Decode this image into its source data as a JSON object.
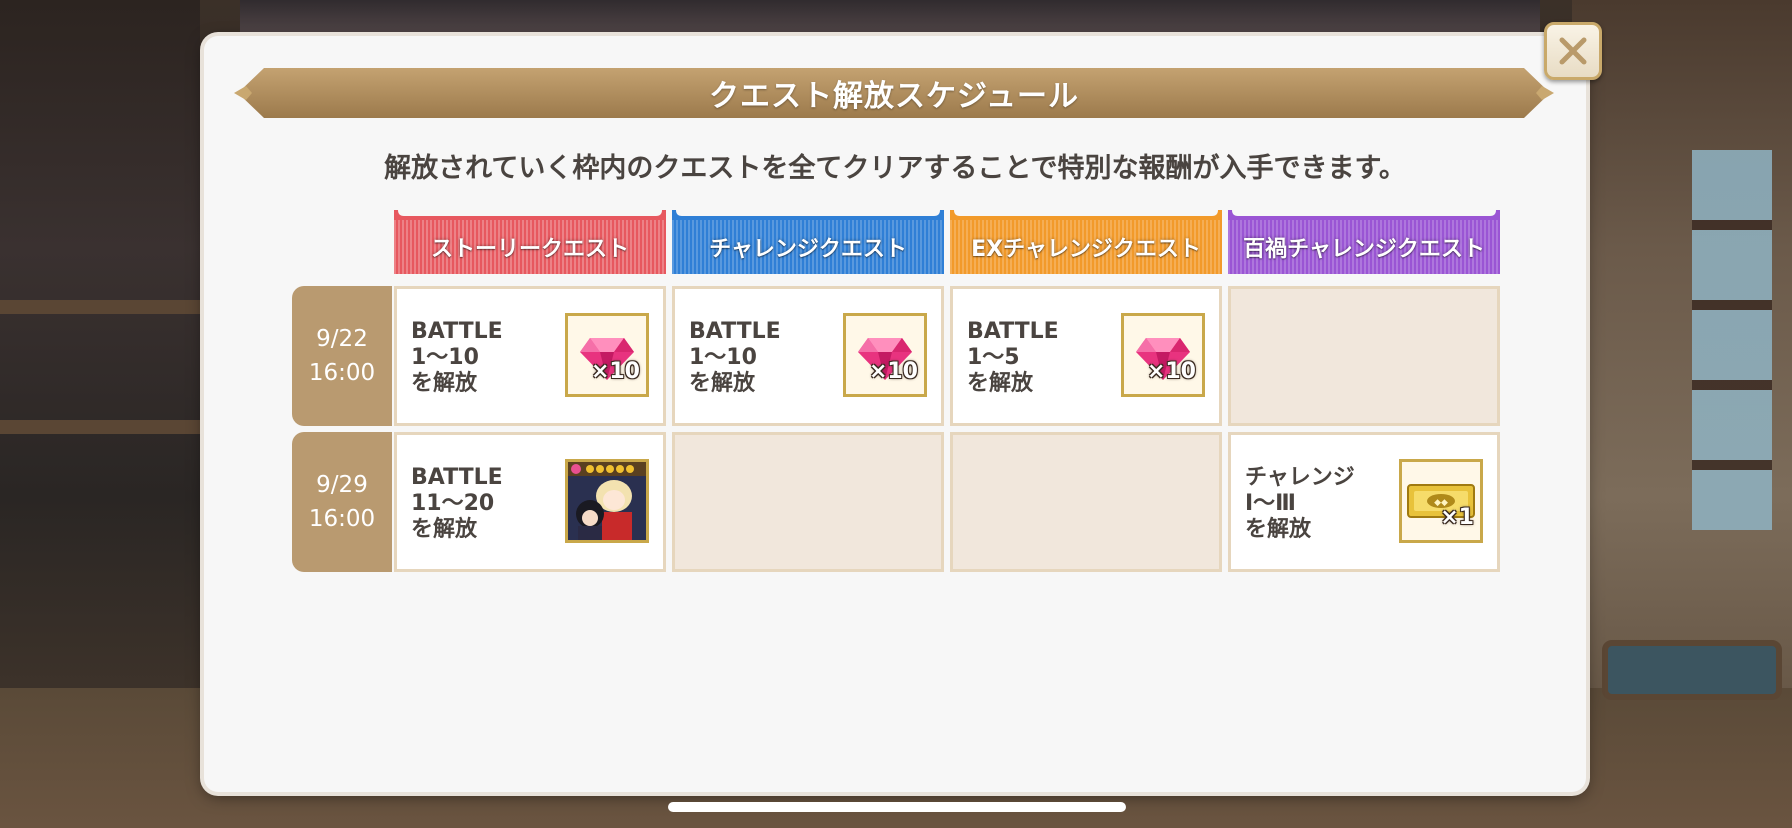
{
  "dialog": {
    "title": "クエスト解放スケジュール",
    "subtitle": "解放されていく枠内のクエストを全てクリアすることで特別な報酬が入手できます。",
    "close_icon": "close-icon"
  },
  "columns": [
    {
      "label": "ストーリークエスト",
      "color": "#e7585f"
    },
    {
      "label": "チャレンジクエスト",
      "color": "#2f7fd6"
    },
    {
      "label": "EXチャレンジクエスト",
      "color": "#f29a2a"
    },
    {
      "label": "百禍チャレンジクエスト",
      "color": "#9a55d4"
    }
  ],
  "rows": [
    {
      "date": "9/22",
      "time": "16:00",
      "cells": [
        {
          "line1": "BATTLE",
          "line2": "1〜10",
          "line3": "を解放",
          "reward_icon": "gem-icon",
          "reward_count": "×10"
        },
        {
          "line1": "BATTLE",
          "line2": "1〜10",
          "line3": "を解放",
          "reward_icon": "gem-icon",
          "reward_count": "×10"
        },
        {
          "line1": "BATTLE",
          "line2": "1〜5",
          "line3": "を解放",
          "reward_icon": "gem-icon",
          "reward_count": "×10"
        },
        null
      ]
    },
    {
      "date": "9/29",
      "time": "16:00",
      "cells": [
        {
          "line1": "BATTLE",
          "line2": "11〜20",
          "line3": "を解放",
          "reward_icon": "character-card-icon",
          "reward_count": ""
        },
        null,
        null,
        {
          "line1": "チャレンジ",
          "line2": "Ⅰ〜Ⅲ",
          "line3": "を解放",
          "reward_icon": "ticket-icon",
          "reward_count": "×1"
        }
      ]
    }
  ]
}
